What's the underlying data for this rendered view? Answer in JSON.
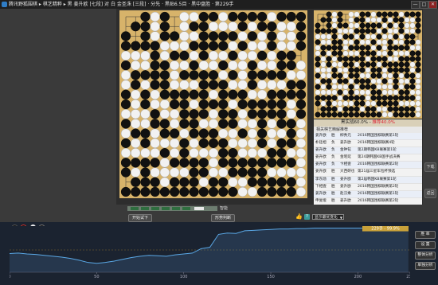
{
  "title_bar": {
    "title": "腾讯野狐围棋 ▸ 棋艺精粹 ▸ 黑 姜升欧 [七段] 对 白 金圣洙 [三段] · 分先 · 黑贴6.5目 · 黑中盘胜 · 第229手",
    "minimize": "—",
    "maximize": "□",
    "close": "✕"
  },
  "side_buttons": {
    "top": "下载",
    "bottom": "返回"
  },
  "win_rate": {
    "black_label": "黑实战60.0%",
    "white_label": "推荐40.0%",
    "separator": " - "
  },
  "records": {
    "header": "相关棋艺精解推荐",
    "rows": [
      {
        "player": "姜升欧",
        "result": "胜",
        "opponent": "柳秀元",
        "event": "2016韩国围棋联赛第1轮"
      },
      {
        "player": "朴廷桓",
        "result": "负",
        "opponent": "姜升欧",
        "event": "2016韩国围棋联赛4轮"
      },
      {
        "player": "姜升欧",
        "result": "负",
        "opponent": "金钟铉",
        "event": "第2期韩国KB联赛第1轮"
      },
      {
        "player": "姜升欧",
        "result": "负",
        "opponent": "金昭延",
        "event": "第24期韩国KB国手战决赛"
      },
      {
        "player": "姜升欧",
        "result": "负",
        "opponent": "卞相壹",
        "event": "2016韩国围棋联赛第2轮"
      },
      {
        "player": "姜升欧",
        "result": "胜",
        "opponent": "大西研也",
        "event": "第21届三星车险杯预选"
      },
      {
        "player": "李东勋",
        "result": "胜",
        "opponent": "姜升欧",
        "event": "第2届韩国KB联赛第1轮"
      },
      {
        "player": "下相壹",
        "result": "胜",
        "opponent": "姜升欧",
        "event": "2016韩国围棋联赛第2轮"
      },
      {
        "player": "姜升欧",
        "result": "胜",
        "opponent": "赵汉乘",
        "event": "2016韩国围棋联赛第1轮"
      },
      {
        "player": "申旻埈",
        "result": "胜",
        "opponent": "姜升欧",
        "event": "2016韩国围棋联赛第2轮"
      },
      {
        "player": "姜升欧",
        "result": "胜",
        "opponent": "朴永训",
        "event": "2016韩国围棋联赛第3轮"
      }
    ]
  },
  "nav": {
    "label": "智能",
    "try_label": "开始试下",
    "analysis_label": "形势判断"
  },
  "help_label": "?",
  "thumb_label": "👍",
  "variation_select": "显示最优变化",
  "graph_controls": {
    "black_dot": "",
    "white_dot": ""
  },
  "right_buttons": [
    "胜  率",
    "设  置",
    "整体分析",
    "单独分析"
  ],
  "colors": {
    "board": "#d7b36a",
    "bottom_bg": "#1b2330",
    "accent_red": "#d23"
  },
  "board": {
    "size": 19,
    "rows": [
      "..bwb.wwbbwbbbbwbbb",
      ".bbwb.wbbwwwbwbbwwb",
      "b.bwbbwwbbbbwbwbwwb",
      "bbbbwwwbbbbwbwwbwwb",
      "wwwbwbbwbwwbwwbwbb.",
      "bwwbbwwbwwbwwbwwbbw",
      "wbbbbwbbbbwbwbbbbww",
      "wbwbbwwwbbbwwbwwwbb",
      "bwbwbbbbbwbbbwwbbbb",
      "bwbwwbbwbbbwbbbbbwb",
      "wwwbwwbbbwbbwbbbbwb",
      "bwwbbwbbwwbbwwbwbbw",
      "wbbwbbwbbbwwbwbwwbw",
      "bwbwwwbwbbbwwwbwbbw",
      "wwwwbwbwwwbbwwwbbww",
      "bbbbwbbbbwbbbbbbbbw",
      "bwbwwwwbbwwbbbbwwww",
      ".bbbwbbbwbbwwbbbbbw",
      "bbbbbbbbbbbbwwbbbbw"
    ]
  },
  "chart_data": {
    "type": "line",
    "title": "",
    "xlabel": "",
    "ylabel": "",
    "x_ticks": [
      0,
      50,
      100,
      150,
      200,
      230
    ],
    "xlim": [
      0,
      230
    ],
    "ylim": [
      0,
      100
    ],
    "value_label": "229手 - 99.9%",
    "series": [
      {
        "x": [
          0,
          5,
          10,
          15,
          20,
          25,
          30,
          35,
          40,
          45,
          50,
          55,
          60,
          65,
          70,
          75,
          80,
          85,
          90,
          95,
          100,
          105,
          110,
          115,
          120,
          125,
          130,
          135,
          140,
          145,
          150,
          155,
          160,
          165,
          170,
          175,
          180,
          185,
          190,
          195,
          200,
          205,
          210,
          215,
          220,
          225,
          229
        ],
        "values": [
          42,
          43,
          41,
          40,
          38,
          36,
          34,
          31,
          27,
          22,
          20,
          22,
          25,
          29,
          33,
          36,
          38,
          37,
          36,
          39,
          41,
          43,
          53,
          56,
          85,
          88,
          87,
          93,
          94,
          95,
          96,
          97,
          97,
          98,
          98,
          99,
          99,
          99,
          99,
          99,
          99,
          99,
          99,
          99,
          99,
          99,
          99.9
        ]
      }
    ]
  }
}
